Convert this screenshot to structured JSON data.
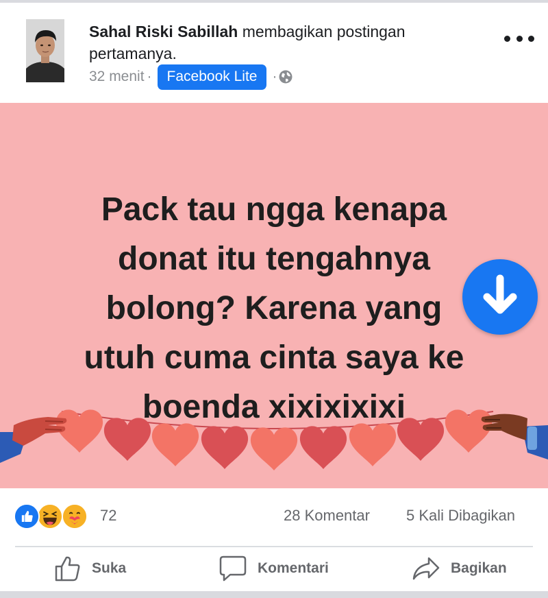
{
  "post": {
    "author_name": "Sahal Riski Sabillah",
    "action_text": "membagikan postingan pertamanya.",
    "time": "32 menit",
    "separator": "·",
    "source_badge": "Facebook Lite",
    "audience_icon": "globe-icon",
    "image_text_lines": [
      "Pack tau ngga kenapa",
      "donat itu tengahnya",
      "bolong? Karena yang",
      "utuh cuma cinta saya ke",
      "boenda xixixixixi"
    ]
  },
  "reactions": {
    "icons": [
      "like-icon",
      "haha-icon",
      "care-icon"
    ],
    "count": "72",
    "comments": "28 Komentar",
    "shares": "5 Kali Dibagikan"
  },
  "actions": {
    "like": "Suka",
    "comment": "Komentari",
    "share": "Bagikan"
  },
  "colors": {
    "brand_blue": "#1877f2",
    "post_background": "#f8b2b3",
    "heart_dark": "#d95055",
    "heart_light": "#f37466",
    "muted_text": "#65676b"
  }
}
